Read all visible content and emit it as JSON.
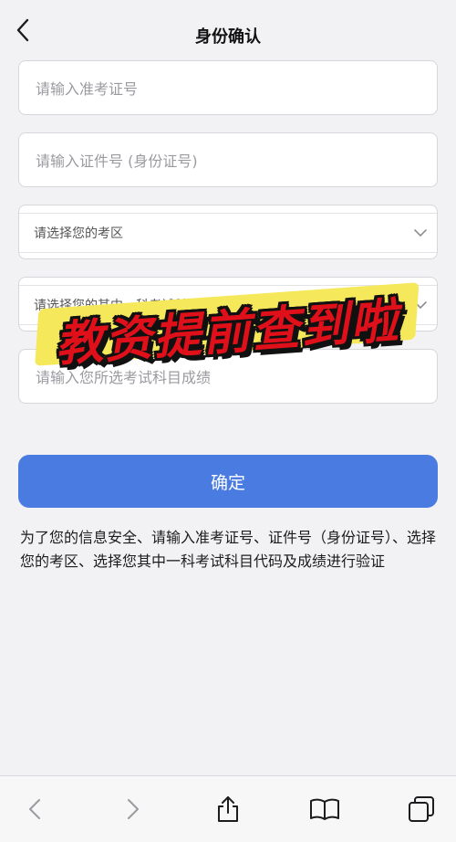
{
  "header": {
    "title": "身份确认",
    "back_icon": "chevron-left-icon"
  },
  "form": {
    "exam_number_placeholder": "请输入准考证号",
    "id_number_placeholder": "请输入证件号 (身份证号)",
    "region_select_placeholder": "请选择您的考区",
    "subject_select_placeholder": "请选择您的其中一科考试科目代码",
    "score_placeholder": "请输入您所选考试科目成绩",
    "confirm_label": "确定"
  },
  "note": "为了您的信息安全、请输入准考证号、证件号（身份证号）、选择您的考区、选择您其中一科考试科目代码及成绩进行验证",
  "overlay_banner": "教资提前查到啦",
  "toolbar": {
    "icons": [
      "back-icon",
      "forward-icon",
      "share-icon",
      "bookmarks-icon",
      "tabs-icon"
    ]
  },
  "colors": {
    "accent": "#4a7be1",
    "banner_text": "#e0101a",
    "banner_highlight": "#f6e85b",
    "background": "#f2f2f4"
  }
}
